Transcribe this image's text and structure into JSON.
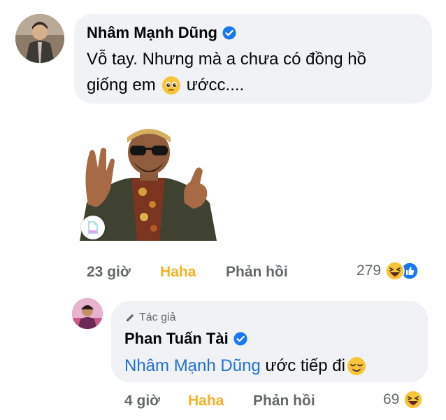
{
  "comment1": {
    "author": "Nhâm Mạnh Dũng",
    "text_line1": "Vỗ tay. Nhưng mà a chưa có đồng hồ",
    "text_line2_before": "giống em",
    "text_line2_after": "ướcc....",
    "time": "23 giờ",
    "reaction_label": "Haha",
    "reply_label": "Phản hồi",
    "reaction_count": "279"
  },
  "reply1": {
    "badge": "Tác giả",
    "author": "Phan Tuấn Tài",
    "mention": "Nhâm Mạnh Dũng",
    "text": " ước tiếp đi",
    "time": "4 giờ",
    "reaction_label": "Haha",
    "reply_label": "Phản hồi",
    "reaction_count": "69"
  },
  "colors": {
    "haha": "#f7b125",
    "meta": "#65676b",
    "mention": "#216fdb",
    "verified": "#1877f2",
    "bubble": "#f0f2f5"
  }
}
